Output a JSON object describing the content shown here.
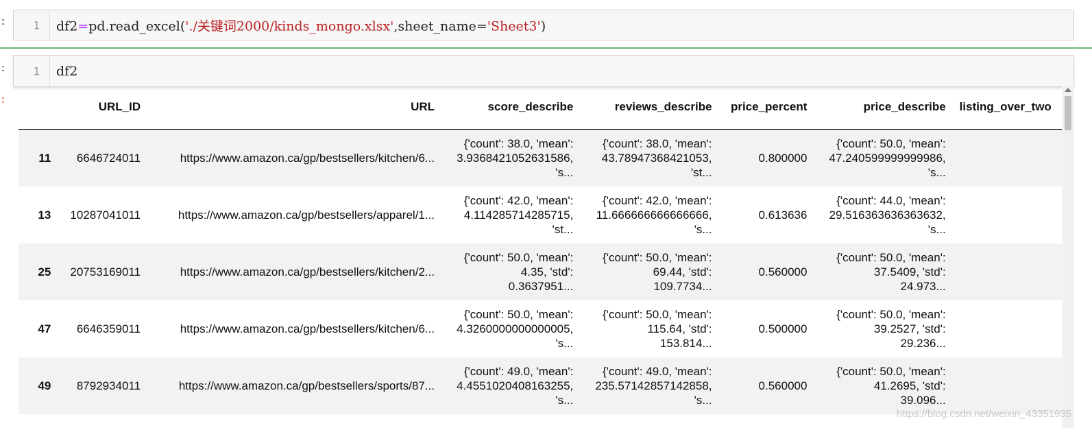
{
  "cells": [
    {
      "prompt": ":",
      "line_number": "1",
      "code_parts": [
        "df2",
        "=",
        "pd.read_excel(",
        "'./关键词2000/kinds_mongo.xlsx'",
        ",sheet_name=",
        "'Sheet3'",
        ")"
      ]
    },
    {
      "prompt": ":",
      "line_number": "1",
      "code": "df2"
    }
  ],
  "output": {
    "prompt": ":",
    "columns": [
      "",
      "URL_ID",
      "URL",
      "score_describe",
      "reviews_describe",
      "price_percent",
      "price_describe",
      "listing_over_two"
    ],
    "rows": [
      {
        "index": "11",
        "url_id": "6646724011",
        "url": "https://www.amazon.ca/gp/bestsellers/kitchen/6...",
        "score_describe": "{'count': 38.0, 'mean':\n3.9368421052631586,\n's...",
        "reviews_describe": "{'count': 38.0, 'mean':\n43.78947368421053,\n'st...",
        "price_percent": "0.800000",
        "price_describe": "{'count': 50.0, 'mean':\n47.240599999999986,\n's..."
      },
      {
        "index": "13",
        "url_id": "10287041011",
        "url": "https://www.amazon.ca/gp/bestsellers/apparel/1...",
        "score_describe": "{'count': 42.0, 'mean':\n4.114285714285715,\n'st...",
        "reviews_describe": "{'count': 42.0, 'mean':\n11.666666666666666,\n's...",
        "price_percent": "0.613636",
        "price_describe": "{'count': 44.0, 'mean':\n29.516363636363632,\n's..."
      },
      {
        "index": "25",
        "url_id": "20753169011",
        "url": "https://www.amazon.ca/gp/bestsellers/kitchen/2...",
        "score_describe": "{'count': 50.0, 'mean':\n4.35, 'std':\n0.3637951...",
        "reviews_describe": "{'count': 50.0, 'mean':\n69.44, 'std':\n109.7734...",
        "price_percent": "0.560000",
        "price_describe": "{'count': 50.0, 'mean':\n37.5409, 'std':\n24.973..."
      },
      {
        "index": "47",
        "url_id": "6646359011",
        "url": "https://www.amazon.ca/gp/bestsellers/kitchen/6...",
        "score_describe": "{'count': 50.0, 'mean':\n4.3260000000000005,\n's...",
        "reviews_describe": "{'count': 50.0, 'mean':\n115.64, 'std':\n153.814...",
        "price_percent": "0.500000",
        "price_describe": "{'count': 50.0, 'mean':\n39.2527, 'std':\n29.236..."
      },
      {
        "index": "49",
        "url_id": "8792934011",
        "url": "https://www.amazon.ca/gp/bestsellers/sports/87...",
        "score_describe": "{'count': 49.0, 'mean':\n4.4551020408163255,\n's...",
        "reviews_describe": "{'count': 49.0, 'mean':\n235.57142857142858,\n's...",
        "price_percent": "0.560000",
        "price_describe": "{'count': 50.0, 'mean':\n41.2695, 'std':\n39.096..."
      }
    ]
  },
  "watermark": "https://blog.csdn.net/weixin_43351935",
  "colors": {
    "string_literal": "#ba2121",
    "operator": "#aa22ff",
    "out_prompt": "#d84315",
    "cell_divider": "#66bb6a"
  }
}
